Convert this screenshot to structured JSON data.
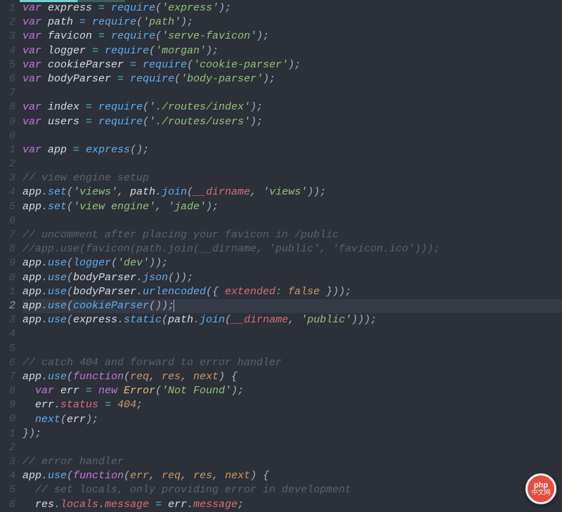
{
  "editor": {
    "highlighted_line_index": 21,
    "lines": [
      {
        "n": "1",
        "tokens": [
          [
            "kw",
            "var"
          ],
          [
            "id",
            " express "
          ],
          [
            "op",
            "="
          ],
          [
            "id",
            " "
          ],
          [
            "fn",
            "require"
          ],
          [
            "punc",
            "("
          ],
          [
            "str",
            "'express'"
          ],
          [
            "punc",
            ");"
          ]
        ]
      },
      {
        "n": "2",
        "tokens": [
          [
            "kw",
            "var"
          ],
          [
            "id",
            " path "
          ],
          [
            "op",
            "="
          ],
          [
            "id",
            " "
          ],
          [
            "fn",
            "require"
          ],
          [
            "punc",
            "("
          ],
          [
            "str",
            "'path'"
          ],
          [
            "punc",
            ");"
          ]
        ]
      },
      {
        "n": "3",
        "tokens": [
          [
            "kw",
            "var"
          ],
          [
            "id",
            " favicon "
          ],
          [
            "op",
            "="
          ],
          [
            "id",
            " "
          ],
          [
            "fn",
            "require"
          ],
          [
            "punc",
            "("
          ],
          [
            "str",
            "'serve-favicon'"
          ],
          [
            "punc",
            ");"
          ]
        ]
      },
      {
        "n": "4",
        "tokens": [
          [
            "kw",
            "var"
          ],
          [
            "id",
            " logger "
          ],
          [
            "op",
            "="
          ],
          [
            "id",
            " "
          ],
          [
            "fn",
            "require"
          ],
          [
            "punc",
            "("
          ],
          [
            "str",
            "'morgan'"
          ],
          [
            "punc",
            ");"
          ]
        ]
      },
      {
        "n": "5",
        "tokens": [
          [
            "kw",
            "var"
          ],
          [
            "id",
            " cookieParser "
          ],
          [
            "op",
            "="
          ],
          [
            "id",
            " "
          ],
          [
            "fn",
            "require"
          ],
          [
            "punc",
            "("
          ],
          [
            "str",
            "'cookie-parser'"
          ],
          [
            "punc",
            ");"
          ]
        ]
      },
      {
        "n": "6",
        "tokens": [
          [
            "kw",
            "var"
          ],
          [
            "id",
            " bodyParser "
          ],
          [
            "op",
            "="
          ],
          [
            "id",
            " "
          ],
          [
            "fn",
            "require"
          ],
          [
            "punc",
            "("
          ],
          [
            "str",
            "'body-parser'"
          ],
          [
            "punc",
            ");"
          ]
        ]
      },
      {
        "n": "7",
        "tokens": []
      },
      {
        "n": "8",
        "tokens": [
          [
            "kw",
            "var"
          ],
          [
            "id",
            " index "
          ],
          [
            "op",
            "="
          ],
          [
            "id",
            " "
          ],
          [
            "fn",
            "require"
          ],
          [
            "punc",
            "("
          ],
          [
            "str",
            "'./routes/index'"
          ],
          [
            "punc",
            ");"
          ]
        ]
      },
      {
        "n": "9",
        "tokens": [
          [
            "kw",
            "var"
          ],
          [
            "id",
            " users "
          ],
          [
            "op",
            "="
          ],
          [
            "id",
            " "
          ],
          [
            "fn",
            "require"
          ],
          [
            "punc",
            "("
          ],
          [
            "str",
            "'./routes/users'"
          ],
          [
            "punc",
            ");"
          ]
        ]
      },
      {
        "n": "0",
        "tokens": []
      },
      {
        "n": "1",
        "tokens": [
          [
            "kw",
            "var"
          ],
          [
            "id",
            " app "
          ],
          [
            "op",
            "="
          ],
          [
            "id",
            " "
          ],
          [
            "fn",
            "express"
          ],
          [
            "punc",
            "();"
          ]
        ]
      },
      {
        "n": "2",
        "tokens": []
      },
      {
        "n": "3",
        "tokens": [
          [
            "cmt",
            "// view engine setup"
          ]
        ]
      },
      {
        "n": "4",
        "tokens": [
          [
            "id",
            "app"
          ],
          [
            "punc",
            "."
          ],
          [
            "fn",
            "set"
          ],
          [
            "punc",
            "("
          ],
          [
            "str",
            "'views'"
          ],
          [
            "punc",
            ", "
          ],
          [
            "id",
            "path"
          ],
          [
            "punc",
            "."
          ],
          [
            "fn",
            "join"
          ],
          [
            "punc",
            "("
          ],
          [
            "glb",
            "__dirname"
          ],
          [
            "punc",
            ", "
          ],
          [
            "str",
            "'views'"
          ],
          [
            "punc",
            "));"
          ]
        ]
      },
      {
        "n": "5",
        "tokens": [
          [
            "id",
            "app"
          ],
          [
            "punc",
            "."
          ],
          [
            "fn",
            "set"
          ],
          [
            "punc",
            "("
          ],
          [
            "str",
            "'view engine'"
          ],
          [
            "punc",
            ", "
          ],
          [
            "str",
            "'jade'"
          ],
          [
            "punc",
            ");"
          ]
        ]
      },
      {
        "n": "6",
        "tokens": []
      },
      {
        "n": "7",
        "tokens": [
          [
            "cmt",
            "// uncomment after placing your favicon in /public"
          ]
        ]
      },
      {
        "n": "8",
        "tokens": [
          [
            "cmt",
            "//app.use(favicon(path.join(__dirname, 'public', 'favicon.ico')));"
          ]
        ]
      },
      {
        "n": "9",
        "tokens": [
          [
            "id",
            "app"
          ],
          [
            "punc",
            "."
          ],
          [
            "fn",
            "use"
          ],
          [
            "punc",
            "("
          ],
          [
            "fn",
            "logger"
          ],
          [
            "punc",
            "("
          ],
          [
            "str",
            "'dev'"
          ],
          [
            "punc",
            "));"
          ]
        ]
      },
      {
        "n": "0",
        "tokens": [
          [
            "id",
            "app"
          ],
          [
            "punc",
            "."
          ],
          [
            "fn",
            "use"
          ],
          [
            "punc",
            "("
          ],
          [
            "id",
            "bodyParser"
          ],
          [
            "punc",
            "."
          ],
          [
            "fn",
            "json"
          ],
          [
            "punc",
            "());"
          ]
        ]
      },
      {
        "n": "1",
        "tokens": [
          [
            "id",
            "app"
          ],
          [
            "punc",
            "."
          ],
          [
            "fn",
            "use"
          ],
          [
            "punc",
            "("
          ],
          [
            "id",
            "bodyParser"
          ],
          [
            "punc",
            "."
          ],
          [
            "fn",
            "urlencoded"
          ],
          [
            "punc",
            "({ "
          ],
          [
            "prop",
            "extended"
          ],
          [
            "op",
            ":"
          ],
          [
            "punc",
            " "
          ],
          [
            "bool",
            "false"
          ],
          [
            "punc",
            " }));"
          ]
        ]
      },
      {
        "n": "2",
        "tokens": [
          [
            "id",
            "app"
          ],
          [
            "punc",
            "."
          ],
          [
            "fn",
            "use"
          ],
          [
            "punc",
            "("
          ],
          [
            "fn",
            "cookieParser"
          ],
          [
            "punc",
            "());"
          ],
          [
            "cursor",
            "|"
          ]
        ]
      },
      {
        "n": "3",
        "tokens": [
          [
            "id",
            "app"
          ],
          [
            "punc",
            "."
          ],
          [
            "fn",
            "use"
          ],
          [
            "punc",
            "("
          ],
          [
            "id",
            "express"
          ],
          [
            "punc",
            "."
          ],
          [
            "fn",
            "static"
          ],
          [
            "punc",
            "("
          ],
          [
            "id",
            "path"
          ],
          [
            "punc",
            "."
          ],
          [
            "fn",
            "join"
          ],
          [
            "punc",
            "("
          ],
          [
            "glb",
            "__dirname"
          ],
          [
            "punc",
            ", "
          ],
          [
            "str",
            "'public'"
          ],
          [
            "punc",
            ")));"
          ]
        ]
      },
      {
        "n": "4",
        "tokens": []
      },
      {
        "n": "5",
        "tokens": []
      },
      {
        "n": "6",
        "tokens": [
          [
            "cmt",
            "// catch 404 and forward to error handler"
          ]
        ]
      },
      {
        "n": "7",
        "tokens": [
          [
            "id",
            "app"
          ],
          [
            "punc",
            "."
          ],
          [
            "fn",
            "use"
          ],
          [
            "punc",
            "("
          ],
          [
            "kw",
            "function"
          ],
          [
            "punc",
            "("
          ],
          [
            "arg",
            "req"
          ],
          [
            "punc",
            ", "
          ],
          [
            "arg",
            "res"
          ],
          [
            "punc",
            ", "
          ],
          [
            "arg",
            "next"
          ],
          [
            "punc",
            ") {"
          ]
        ]
      },
      {
        "n": "8",
        "tokens": [
          [
            "id",
            "  "
          ],
          [
            "kw",
            "var"
          ],
          [
            "id",
            " err "
          ],
          [
            "op",
            "="
          ],
          [
            "id",
            " "
          ],
          [
            "kw",
            "new"
          ],
          [
            "id",
            " "
          ],
          [
            "err",
            "Error"
          ],
          [
            "punc",
            "("
          ],
          [
            "str",
            "'Not Found'"
          ],
          [
            "punc",
            ");"
          ]
        ]
      },
      {
        "n": "9",
        "tokens": [
          [
            "id",
            "  err"
          ],
          [
            "punc",
            "."
          ],
          [
            "prop",
            "status"
          ],
          [
            "id",
            " "
          ],
          [
            "op",
            "="
          ],
          [
            "id",
            " "
          ],
          [
            "num",
            "404"
          ],
          [
            "punc",
            ";"
          ]
        ]
      },
      {
        "n": "0",
        "tokens": [
          [
            "id",
            "  "
          ],
          [
            "fn",
            "next"
          ],
          [
            "punc",
            "("
          ],
          [
            "id",
            "err"
          ],
          [
            "punc",
            ");"
          ]
        ]
      },
      {
        "n": "1",
        "tokens": [
          [
            "punc",
            "});"
          ]
        ]
      },
      {
        "n": "2",
        "tokens": []
      },
      {
        "n": "3",
        "tokens": [
          [
            "cmt",
            "// error handler"
          ]
        ]
      },
      {
        "n": "4",
        "tokens": [
          [
            "id",
            "app"
          ],
          [
            "punc",
            "."
          ],
          [
            "fn",
            "use"
          ],
          [
            "punc",
            "("
          ],
          [
            "kw",
            "function"
          ],
          [
            "punc",
            "("
          ],
          [
            "arg",
            "err"
          ],
          [
            "punc",
            ", "
          ],
          [
            "arg",
            "req"
          ],
          [
            "punc",
            ", "
          ],
          [
            "arg",
            "res"
          ],
          [
            "punc",
            ", "
          ],
          [
            "arg",
            "next"
          ],
          [
            "punc",
            ") {"
          ]
        ]
      },
      {
        "n": "5",
        "tokens": [
          [
            "id",
            "  "
          ],
          [
            "cmt",
            "// set locals, only providing error in development"
          ]
        ]
      },
      {
        "n": "6",
        "tokens": [
          [
            "id",
            "  res"
          ],
          [
            "punc",
            "."
          ],
          [
            "prop",
            "locals"
          ],
          [
            "punc",
            "."
          ],
          [
            "prop",
            "message"
          ],
          [
            "id",
            " "
          ],
          [
            "op",
            "="
          ],
          [
            "id",
            " err"
          ],
          [
            "punc",
            "."
          ],
          [
            "prop",
            "message"
          ],
          [
            "punc",
            ";"
          ]
        ]
      }
    ]
  },
  "badge": {
    "top": "php",
    "bot": "中文网"
  }
}
